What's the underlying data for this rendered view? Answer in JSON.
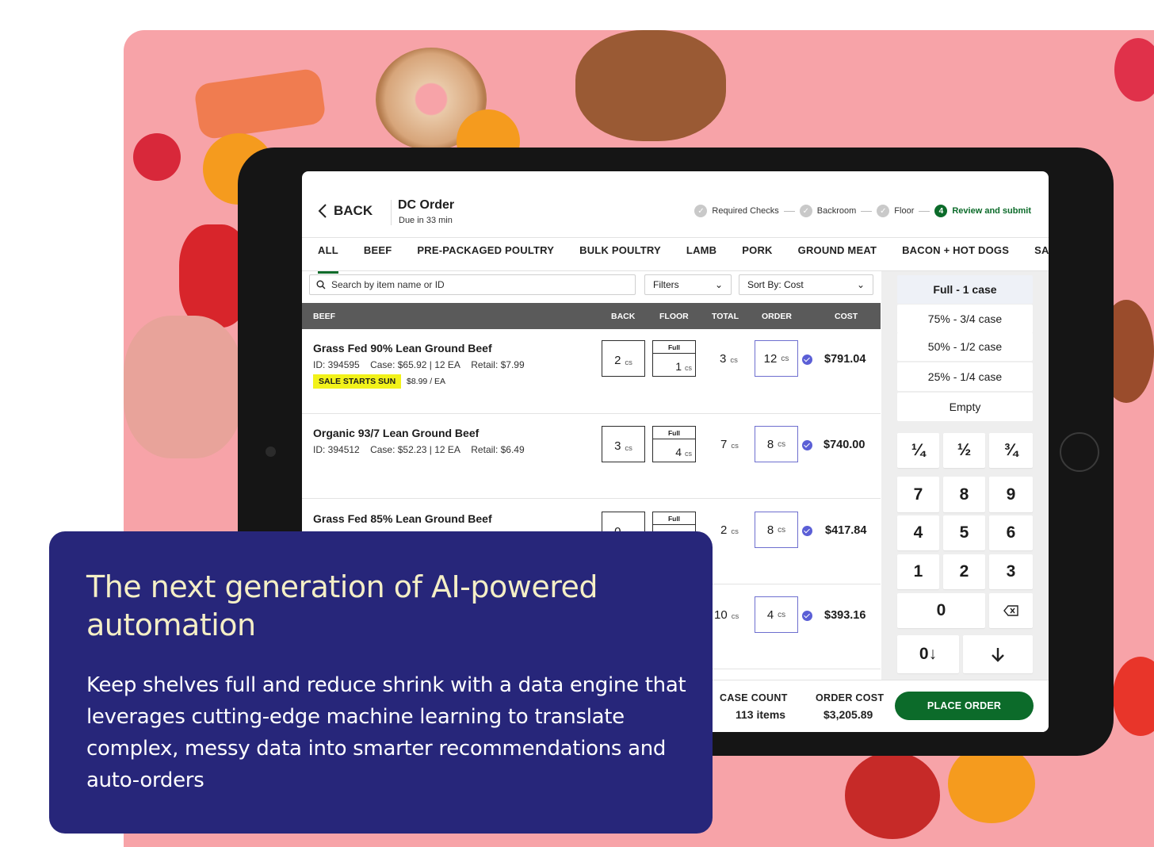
{
  "colors": {
    "background_pink": "#f7a3a8",
    "brand_green": "#0c6b2a",
    "card_navy": "#27267a",
    "headline_cream": "#f5efc6",
    "accent_purple": "#5b5fd6",
    "sale_yellow": "#f2f21a"
  },
  "header": {
    "back_label": "BACK",
    "title": "DC Order",
    "due": "Due in 33 min",
    "steps": [
      {
        "label": "Required Checks",
        "icon": "check-circle-icon"
      },
      {
        "label": "Backroom",
        "icon": "check-circle-icon"
      },
      {
        "label": "Floor",
        "icon": "check-circle-icon"
      },
      {
        "label": "Review and submit",
        "number": "4",
        "active": true
      }
    ]
  },
  "tabs": [
    "ALL",
    "BEEF",
    "PRE-PACKAGED POULTRY",
    "BULK POULTRY",
    "LAMB",
    "PORK",
    "GROUND MEAT",
    "BACON + HOT DOGS",
    "SAUSAGES"
  ],
  "active_tab": "ALL",
  "search": {
    "placeholder": "Search by item name or ID"
  },
  "filters_label": "Filters",
  "sort_label": "Sort By: Cost",
  "table": {
    "section": "BEEF",
    "columns": [
      "BACK",
      "FLOOR",
      "TOTAL",
      "ORDER",
      "COST"
    ],
    "rows": [
      {
        "name": "Grass Fed 90% Lean Ground Beef",
        "id": "ID: 394595",
        "case": "Case: $65.92 | 12 EA",
        "retail": "Retail: $7.99",
        "sale_badge": "SALE STARTS SUN",
        "sale_price": "$8.99 / EA",
        "back": "2",
        "floor_label": "Full",
        "floor": "1",
        "total": "3",
        "order": "12",
        "cost": "$791.04"
      },
      {
        "name": "Organic 93/7 Lean Ground Beef",
        "id": "ID: 394512",
        "case": "Case: $52.23 | 12 EA",
        "retail": "Retail: $6.49",
        "back": "3",
        "floor_label": "Full",
        "floor": "4",
        "total": "7",
        "order": "8",
        "cost": "$740.00"
      },
      {
        "name": "Grass Fed 85% Lean Ground Beef",
        "back": "0",
        "floor_label": "Full",
        "total": "2",
        "order": "8",
        "cost": "$417.84"
      },
      {
        "total": "10",
        "order": "4",
        "cost": "$393.16"
      }
    ],
    "unit": "cs"
  },
  "presets": [
    "Full - 1 case",
    "75% - 3/4 case",
    "50% - 1/2 case",
    "25% - 1/4 case",
    "Empty"
  ],
  "selected_preset": "Full - 1 case",
  "keypad": {
    "fractions": [
      "¼",
      "½",
      "¾"
    ],
    "digits": [
      "7",
      "8",
      "9",
      "4",
      "5",
      "6",
      "1",
      "2",
      "3"
    ],
    "zero": "0",
    "backspace_icon": "backspace-icon",
    "zero_down": "0↓",
    "down_icon": "arrow-down-icon"
  },
  "footer": {
    "case_count_label": "CASE COUNT",
    "case_count_value": "113 items",
    "order_cost_label": "ORDER COST",
    "order_cost_value": "$3,205.89",
    "place_order_label": "PLACE ORDER"
  },
  "card": {
    "headline": "The next generation of AI-powered automation",
    "body": "Keep shelves full and reduce shrink with a data engine that leverages cutting-edge machine learning to translate complex, messy data into smarter recommendations and auto-orders"
  }
}
